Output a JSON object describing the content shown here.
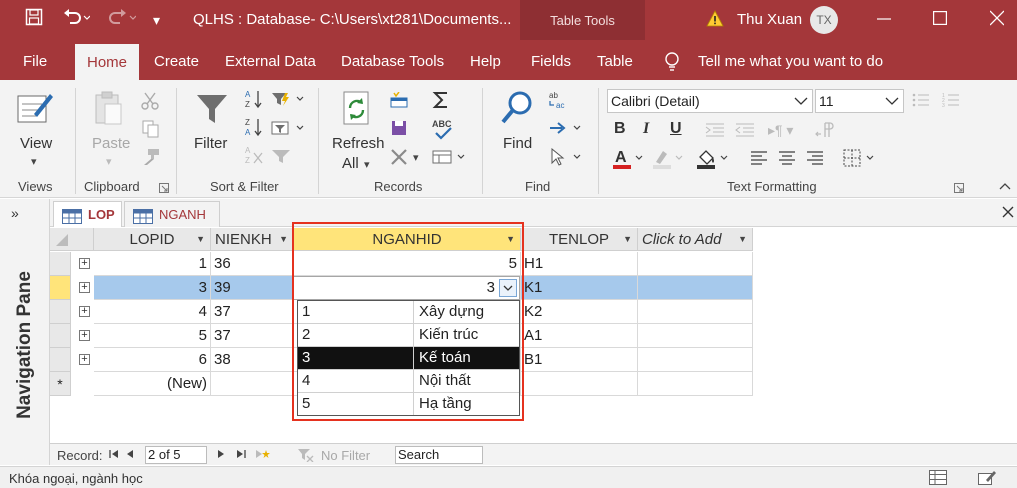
{
  "titlebar": {
    "doc_title": "QLHS : Database- C:\\Users\\xt281\\Documents...",
    "contextual_tab_group": "Table Tools",
    "user_name": "Thu Xuan",
    "user_initials": "TX"
  },
  "ribbon_tabs": [
    "File",
    "Home",
    "Create",
    "External Data",
    "Database Tools",
    "Help",
    "Fields",
    "Table"
  ],
  "tell_me": "Tell me what you want to do",
  "ribbon": {
    "view_label": "View",
    "paste_label": "Paste",
    "filter_label": "Filter",
    "refresh_label": "Refresh",
    "refresh_label2": "All",
    "find_label": "Find",
    "font_name": "Calibri (Detail)",
    "font_size": "11",
    "groups": {
      "views": "Views",
      "clipboard": "Clipboard",
      "sort_filter": "Sort & Filter",
      "records": "Records",
      "find": "Find",
      "text_formatting": "Text Formatting"
    }
  },
  "nav_pane": {
    "title": "Navigation Pane",
    "toggle": "»"
  },
  "doc_tabs": [
    {
      "label": "LOP",
      "active": true
    },
    {
      "label": "NGANH",
      "active": false
    }
  ],
  "table": {
    "columns": [
      "LOPID",
      "NIENKH",
      "NGANHID",
      "TENLOP",
      "Click to Add"
    ],
    "rows": [
      {
        "lopid": "1",
        "nienkh": "36",
        "nganhid": "5",
        "tenlop": "H1"
      },
      {
        "lopid": "3",
        "nienkh": "39",
        "nganhid": "3",
        "tenlop": "K1"
      },
      {
        "lopid": "4",
        "nienkh": "37",
        "nganhid": "",
        "tenlop": "K2"
      },
      {
        "lopid": "5",
        "nienkh": "37",
        "nganhid": "",
        "tenlop": "A1"
      },
      {
        "lopid": "6",
        "nienkh": "38",
        "nganhid": "",
        "tenlop": "B1"
      }
    ],
    "new_row_label": "(New)",
    "new_row_marker": "*"
  },
  "lookup": {
    "current_value": "3",
    "options": [
      {
        "id": "1",
        "name": "Xây dựng"
      },
      {
        "id": "2",
        "name": "Kiến trúc"
      },
      {
        "id": "3",
        "name": "Kế toán",
        "selected": true
      },
      {
        "id": "4",
        "name": "Nội thất"
      },
      {
        "id": "5",
        "name": "Hạ tầng"
      }
    ]
  },
  "record_nav": {
    "label": "Record:",
    "position": "2 of 5",
    "filter_label": "No Filter",
    "search_label": "Search"
  },
  "status": {
    "message": "Khóa ngoại, ngành học"
  },
  "colors": {
    "accent": "#a4373a",
    "selection": "#a6c9ec",
    "highlight_header": "#ffe47a",
    "annotation": "#e5321f"
  }
}
